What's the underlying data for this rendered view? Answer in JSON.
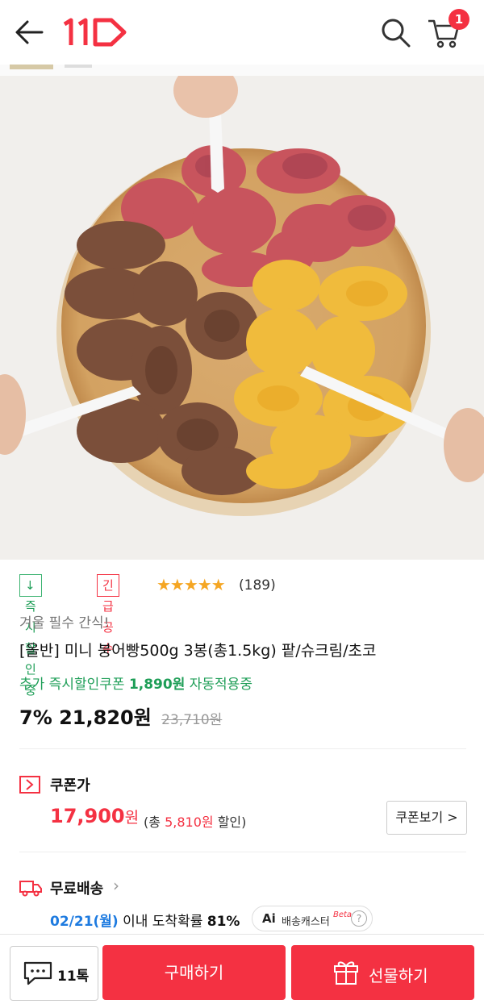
{
  "header": {
    "back": "back-arrow-icon",
    "logo": "11",
    "cart_count": "1"
  },
  "gallery": {
    "image": "mini bungeoppang platter",
    "current_index": 2,
    "total": 4
  },
  "badges": {
    "certified": "↓즉시할인중",
    "urgent": "긴급공수",
    "rating_stars": "★★★★★",
    "rating_value": 4.5,
    "review_count": "(189)"
  },
  "product": {
    "subtitle": "겨울 필수 간식!",
    "title": "[올반] 미니 붕어빵500g 3봉(총1.5kg) 팥/슈크림/초코",
    "auto_coupon_prefix": "추가 즉시할인쿠폰",
    "auto_coupon_amount": "1,890원",
    "auto_coupon_suffix": "자동적용중",
    "discount": "7%",
    "price": "21,820원",
    "original_price": "23,710원"
  },
  "coupon": {
    "label": "쿠폰가",
    "price": "17,900",
    "unit": "원",
    "note_prefix": "(총",
    "note_amount": "5,810원",
    "note_suffix": "할인)",
    "button": "쿠폰보기 >"
  },
  "shipping": {
    "label": "무료배송",
    "arrow": "›",
    "date": "02/21(월)",
    "date_suffix": "이내 도착확률",
    "probability": "81%",
    "ai_label": "Ai",
    "ai_text": "배송캐스터",
    "ai_beta": "Beta",
    "help": "?"
  },
  "bottom_bar": {
    "talk": "11톡",
    "buy": "구매하기",
    "gift": "선물하기"
  },
  "colors": {
    "brand_red": "#f43142",
    "green": "#1e9e57",
    "blue": "#1e7be0"
  }
}
